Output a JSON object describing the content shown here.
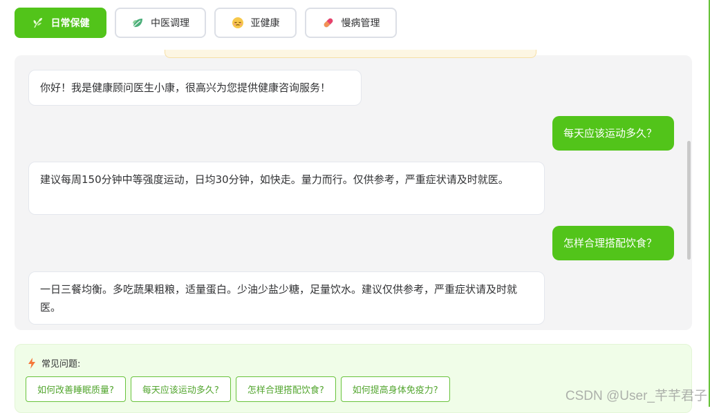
{
  "tabs": [
    {
      "label": "日常保健",
      "icon": "leaf-sprout-icon",
      "active": true
    },
    {
      "label": "中医调理",
      "icon": "herb-leaf-icon",
      "active": false
    },
    {
      "label": "亚健康",
      "icon": "tired-face-icon",
      "active": false
    },
    {
      "label": "慢病管理",
      "icon": "pill-icon",
      "active": false
    }
  ],
  "chat": {
    "messages": [
      {
        "role": "bot",
        "text": "你好！我是健康顾问医生小康，很高兴为您提供健康咨询服务！"
      },
      {
        "role": "user",
        "text": "每天应该运动多久？"
      },
      {
        "role": "bot",
        "text": "建议每周150分钟中等强度运动，日均30分钟，如快走。量力而行。仅供参考，严重症状请及时就医。"
      },
      {
        "role": "user",
        "text": "怎样合理搭配饮食？"
      },
      {
        "role": "bot",
        "text": "一日三餐均衡。多吃蔬果粗粮，适量蛋白。少油少盐少糖，足量饮水。建议仅供参考，严重症状请及时就医。"
      }
    ]
  },
  "faq": {
    "title": "常见问题:",
    "icon": "lightning-icon",
    "questions": [
      "如何改善睡眠质量?",
      "每天应该运动多久?",
      "怎样合理搭配饮食?",
      "如何提高身体免疫力?"
    ]
  },
  "watermark": "CSDN @User_芊芊君子",
  "colors": {
    "accent": "#52c41a",
    "panel_bg": "#f4f4f5",
    "faq_bg": "#f0fde8"
  }
}
